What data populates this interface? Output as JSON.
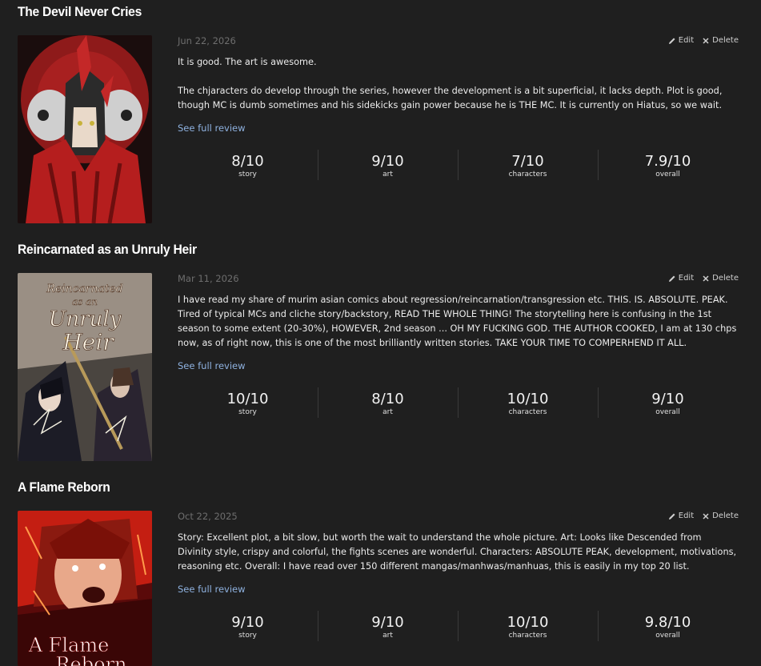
{
  "actions": {
    "edit_label": "Edit",
    "delete_label": "Delete",
    "see_full_label": "See full review"
  },
  "score_labels": [
    "story",
    "art",
    "characters",
    "overall"
  ],
  "reviews": [
    {
      "title": "The Devil Never Cries",
      "date": "Jun 22, 2026",
      "paragraphs": [
        "It is good. The art is awesome.",
        "The chjaracters do develop through the series, however the development is a bit superficial, it lacks depth. Plot is good, though MC is dumb sometimes and his sidekicks gain power because he is THE MC. It is currently on Hiatus, so we wait."
      ],
      "scores": [
        "8/10",
        "9/10",
        "7/10",
        "7.9/10"
      ]
    },
    {
      "title": "Reincarnated as an Unruly Heir",
      "date": "Mar 11, 2026",
      "cover_text": [
        "Reincarnated",
        "as an",
        "Unruly",
        "Heir"
      ],
      "paragraphs": [
        "I have read my share of murim asian comics about regression/reincarnation/transgression etc. THIS. IS. ABSOLUTE. PEAK. Tired of typical MCs and cliche story/backstory, READ THE WHOLE THING! The storytelling here is confusing in the 1st season to some extent (20-30%), HOWEVER, 2nd season ... OH MY FUCKING GOD. THE AUTHOR COOKED, I am at 130 chps now, as of right now, this is one of the most brilliantly written stories. TAKE YOUR TIME TO COMPERHEND IT ALL."
      ],
      "scores": [
        "10/10",
        "8/10",
        "10/10",
        "9/10"
      ]
    },
    {
      "title": "A Flame Reborn",
      "date": "Oct 22, 2025",
      "cover_text": [
        "A Flame",
        "Reborn"
      ],
      "paragraphs": [
        "Story: Excellent plot, a bit slow, but worth the wait to understand the whole picture. Art: Looks like Descended from Divinity style, crispy and colorful, the fights scenes are wonderful. Characters: ABSOLUTE PEAK, development, motivations, reasoning etc. Overall: I have read over 150 different mangas/manhwas/manhuas, this is easily in my top 20 list."
      ],
      "scores": [
        "9/10",
        "9/10",
        "10/10",
        "9.8/10"
      ]
    }
  ]
}
